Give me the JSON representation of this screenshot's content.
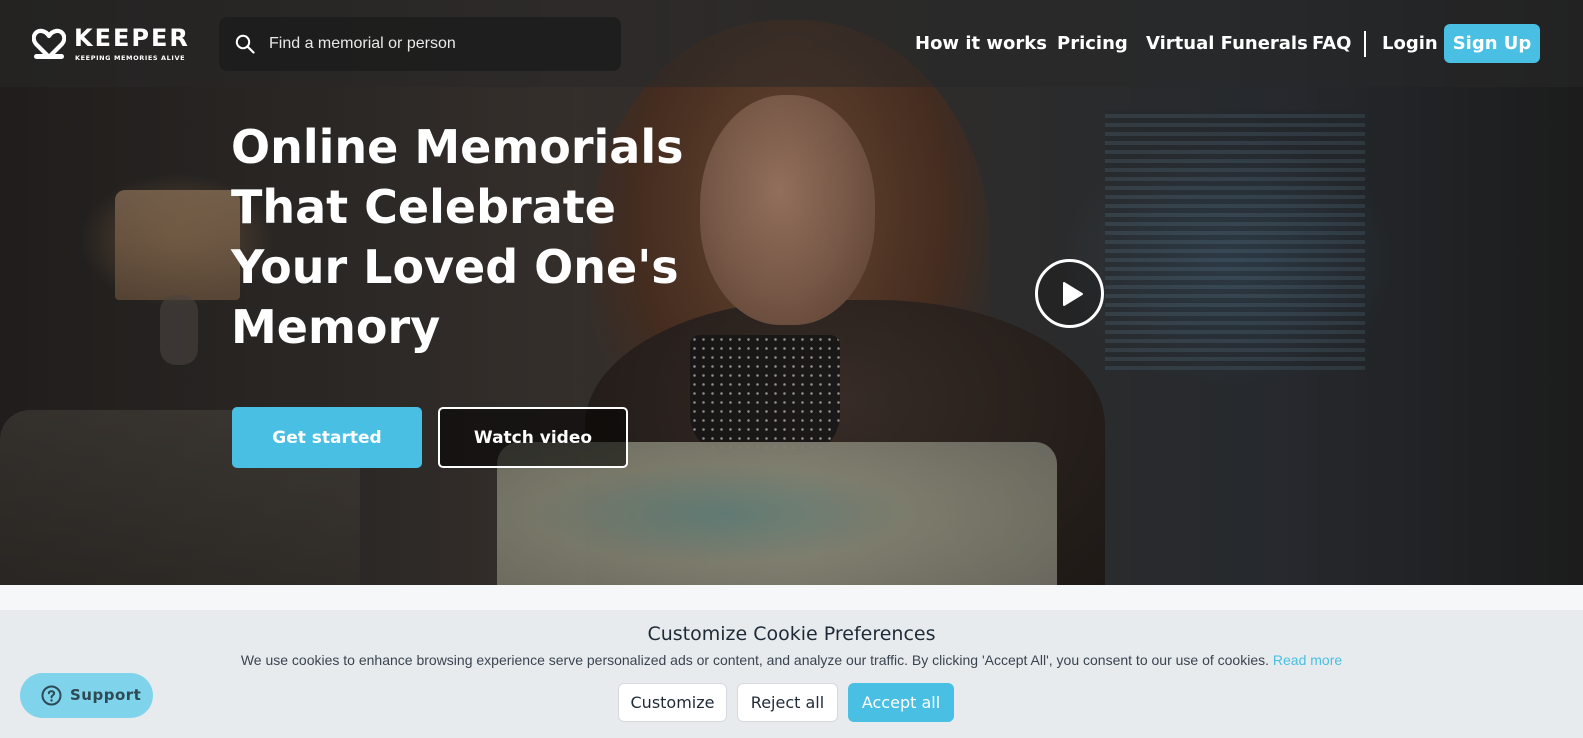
{
  "logo": {
    "name": "KEEPER",
    "tagline": "KEEPING MEMORIES ALIVE",
    "icon": "heart-logo-icon"
  },
  "search": {
    "placeholder": "Find a memorial or person",
    "value": "",
    "icon": "search-icon"
  },
  "nav": {
    "items": [
      "How it works",
      "Pricing",
      "Virtual Funerals",
      "FAQ"
    ],
    "login": "Login",
    "signup": "Sign Up"
  },
  "hero": {
    "headline": [
      "Online Memorials",
      "That Celebrate",
      "Your Loved One's",
      "Memory"
    ],
    "get_started": "Get started",
    "watch_video": "Watch video",
    "play_icon": "play-icon"
  },
  "cookie": {
    "title": "Customize Cookie Preferences",
    "text": "We use cookies to enhance browsing experience serve personalized ads or content, and analyze our traffic. By clicking 'Accept All', you consent to our use of cookies.",
    "read_more": "Read more",
    "customize": "Customize",
    "reject_all": "Reject all",
    "accept_all": "Accept all"
  },
  "support": {
    "label": "Support",
    "icon": "help-circle-icon"
  },
  "colors": {
    "accent": "#48bfe3",
    "support_bg": "#7fd3ea",
    "cookie_bg": "#e8ebee"
  }
}
